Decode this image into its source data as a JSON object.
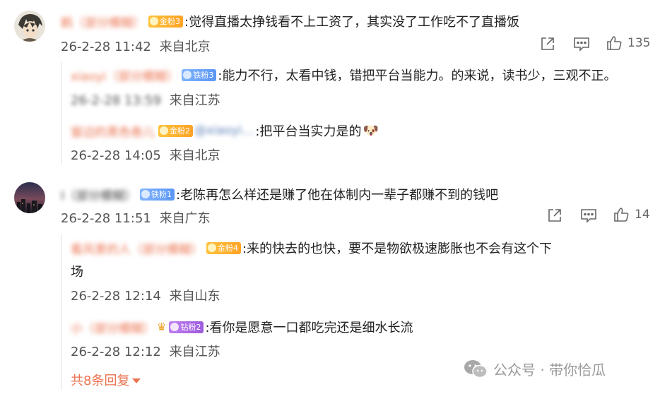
{
  "comments": [
    {
      "user": "鹤（部分模糊）",
      "badge": "金粉3",
      "text": ":觉得直播太挣钱看不上工资了，其实没了工作吃不了直播饭",
      "time": "26-2-28 11:42",
      "location": "来自北京",
      "likes": "135",
      "replies": [
        {
          "user": "xiaoyi（部分模糊）",
          "badge": "铁粉3",
          "text": ":能力不行，太看中钱，错把平台当能力。的来说，读书少，三观不正。",
          "time": "26-2-28 13:59",
          "location": "来自江苏"
        },
        {
          "user": "窗边的黑色卷儿",
          "badge": "金粉2",
          "mention": "@xiaoyi…",
          "text": ":把平台当实力是的",
          "emoji": "🐶",
          "time": "26-2-28 14:05",
          "location": "来自北京"
        }
      ]
    },
    {
      "user": "I（部分模糊）",
      "badge": "铁粉1",
      "text": ":老陈再怎么样还是赚了他在体制内一辈子都赚不到的钱吧",
      "time": "26-2-28 11:51",
      "location": "来自广东",
      "likes": "14",
      "replies": [
        {
          "user": "看风景的人（部分模糊）",
          "badge": "金粉4",
          "text": ":来的快去的也快，要不是物欲极速膨胀也不会有这个下",
          "text2": "场",
          "time": "26-2-28 12:14",
          "location": "来自山东"
        },
        {
          "user": "小（部分模糊）",
          "badge": "钻粉2",
          "text": ":看你是愿意一口都吃完还是细水长流",
          "time": "26-2-28 12:12",
          "location": "来自江苏"
        }
      ],
      "more_replies": "共8条回复"
    }
  ],
  "watermark": "公众号 · 带你恰瓜",
  "icons": {
    "share": "share-icon",
    "comment": "comment-icon",
    "like": "thumbs-up-icon",
    "wechat": "wechat-icon"
  },
  "colors": {
    "username": "#eb7350",
    "gold_badge": "#ffa326",
    "iron_badge": "#5b96f5",
    "drill_badge": "#9c5bdb",
    "meta": "#555555"
  }
}
